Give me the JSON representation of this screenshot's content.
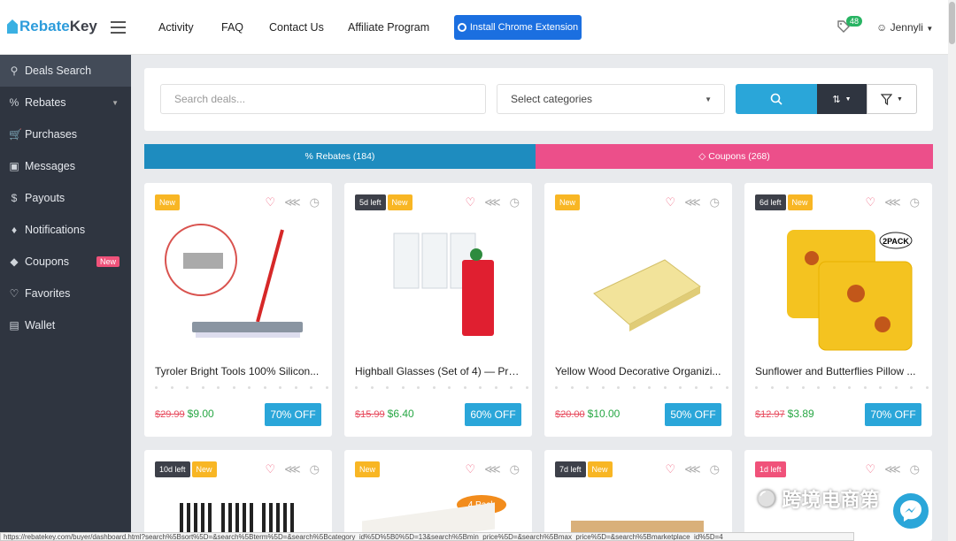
{
  "header": {
    "logo": {
      "part1": "Rebate",
      "part2": "Key"
    },
    "nav": [
      "Activity",
      "FAQ",
      "Contact Us",
      "Affiliate Program"
    ],
    "chrome_button": "Install Chrome Extension",
    "notification_count": "48",
    "user": "Jennyli"
  },
  "sidebar": {
    "items": [
      {
        "label": "Deals Search",
        "icon": "search-icon"
      },
      {
        "label": "Rebates",
        "icon": "percent-icon"
      },
      {
        "label": "Purchases",
        "icon": "cart-icon"
      },
      {
        "label": "Messages",
        "icon": "chat-icon"
      },
      {
        "label": "Payouts",
        "icon": "dollar-icon"
      },
      {
        "label": "Notifications",
        "icon": "bell-icon"
      },
      {
        "label": "Coupons",
        "icon": "tag-icon",
        "badge": "New"
      },
      {
        "label": "Favorites",
        "icon": "heart-icon"
      },
      {
        "label": "Wallet",
        "icon": "wallet-icon"
      }
    ]
  },
  "filters": {
    "search_placeholder": "Search deals...",
    "category_placeholder": "Select categories"
  },
  "tabs": {
    "rebates": "Rebates (184)",
    "coupons": "Coupons (268)"
  },
  "products": [
    {
      "tags": [
        "New"
      ],
      "title": "Tyroler Bright Tools 100% Silicon...",
      "old_price": "$29.99",
      "price": "$9.00",
      "off": "70% OFF"
    },
    {
      "tags": [
        "5d left",
        "New"
      ],
      "title": "Highball Glasses (Set of 4) — Pre...",
      "old_price": "$15.99",
      "price": "$6.40",
      "off": "60% OFF"
    },
    {
      "tags": [
        "New"
      ],
      "title": "Yellow Wood Decorative Organizi...",
      "old_price": "$20.00",
      "price": "$10.00",
      "off": "50% OFF"
    },
    {
      "tags": [
        "6d left",
        "New"
      ],
      "title": "Sunflower and Butterflies Pillow ...",
      "old_price": "$12.97",
      "price": "$3.89",
      "off": "70% OFF"
    },
    {
      "tags": [
        "10d left",
        "New"
      ]
    },
    {
      "tags": [
        "New"
      ],
      "badge": "4 Pack"
    },
    {
      "tags": [
        "7d left",
        "New"
      ]
    },
    {
      "tags": [
        "1d left"
      ]
    }
  ],
  "pillow_badge": "2PACK",
  "status_url": "https://rebatekey.com/buyer/dashboard.html?search%5Bsort%5D=&search%5Bterm%5D=&search%5Bcategory_id%5D%5B0%5D=13&search%5Bmin_price%5D=&search%5Bmax_price%5D=&search%5Bmarketplace_id%5D=4",
  "watermark": "跨境电商第"
}
